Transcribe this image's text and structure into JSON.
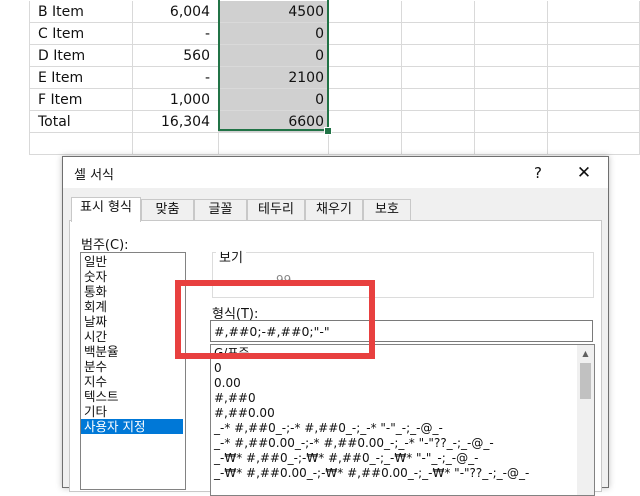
{
  "sheet": {
    "rows": [
      {
        "name": "B Item",
        "b": "6,004",
        "c": "4500"
      },
      {
        "name": "C Item",
        "b": "-",
        "c": "0"
      },
      {
        "name": "D Item",
        "b": "560",
        "c": "0"
      },
      {
        "name": "E Item",
        "b": "-",
        "c": "2100"
      },
      {
        "name": "F Item",
        "b": "1,000",
        "c": "0"
      },
      {
        "name": "Total",
        "b": "16,304",
        "c": "6600"
      }
    ],
    "selection_color": "#217346"
  },
  "dialog": {
    "title": "셀 서식",
    "help_label": "?",
    "close_label": "✕",
    "tabs": [
      "표시 형식",
      "맞춤",
      "글꼴",
      "테두리",
      "채우기",
      "보호"
    ],
    "active_tab": "표시 형식",
    "category_label": "범주(C):",
    "categories": [
      "일반",
      "숫자",
      "통화",
      "회계",
      "날짜",
      "시간",
      "백분율",
      "분수",
      "지수",
      "텍스트",
      "기타",
      "사용자 지정"
    ],
    "selected_category": "사용자 지정",
    "preview_label": "보기",
    "preview_value": "99",
    "format_label": "형식(T):",
    "format_value": "#,##0;-#,##0;\"-\"",
    "format_list": [
      "G/표준",
      "0",
      "0.00",
      "#,##0",
      "#,##0.00",
      "_-* #,##0_-;-* #,##0_-;_-* \"-\"_-;_-@_-",
      "_-* #,##0.00_-;-* #,##0.00_-;_-* \"-\"??_-;_-@_-",
      "_-₩* #,##0_-;-₩* #,##0_-;_-₩* \"-\"_-;_-@_-",
      "_-₩* #,##0.00_-;-₩* #,##0.00_-;_-₩* \"-\"??_-;_-@_-"
    ],
    "selection_color": "#0078d7",
    "highlight_color": "#e8403f"
  }
}
